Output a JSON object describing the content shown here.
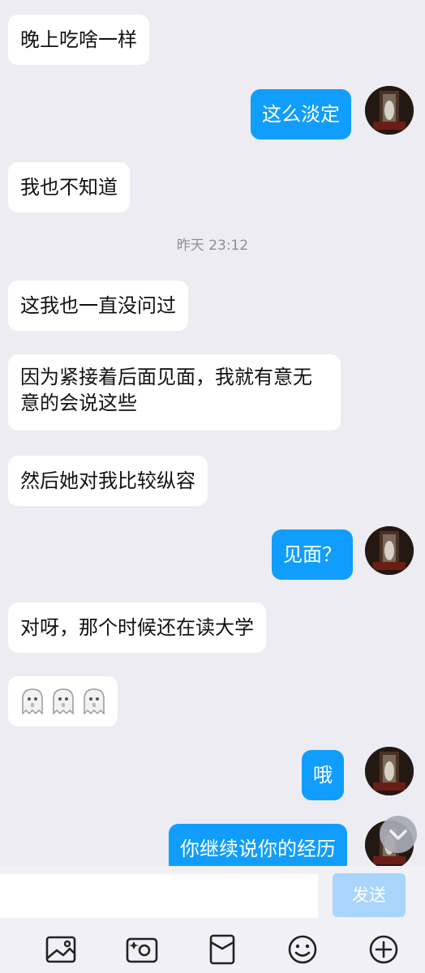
{
  "chat": {
    "messages": [
      {
        "side": "in",
        "text": "晚上吃啥一样"
      },
      {
        "side": "out",
        "text": "这么淡定"
      },
      {
        "side": "in",
        "text": "我也不知道"
      },
      {
        "side": "in",
        "text": "这我也一直没问过"
      },
      {
        "side": "in",
        "text": "因为紧接着后面见面，我就有意无意的会说这些"
      },
      {
        "side": "in",
        "text": "然后她对我比较纵容"
      },
      {
        "side": "out",
        "text": "见面？"
      },
      {
        "side": "in",
        "text": "对呀，那个时候还在读大学"
      },
      {
        "side": "in",
        "text": "",
        "emoji": [
          "ghost",
          "ghost",
          "ghost"
        ]
      },
      {
        "side": "out",
        "text": "哦"
      },
      {
        "side": "out",
        "text": "你继续说你的经历"
      }
    ],
    "timestamp": "昨天 23:12"
  },
  "input": {
    "value": "",
    "placeholder": "",
    "send_label": "发送"
  },
  "toolbar": {
    "items": [
      "image-icon",
      "camera-icon",
      "red-packet-icon",
      "emoji-icon",
      "plus-icon"
    ]
  },
  "colors": {
    "background": "#ececf2",
    "incoming_bubble": "#ffffff",
    "outgoing_bubble": "#119dfb",
    "send_button_disabled": "#a9d4fb"
  }
}
